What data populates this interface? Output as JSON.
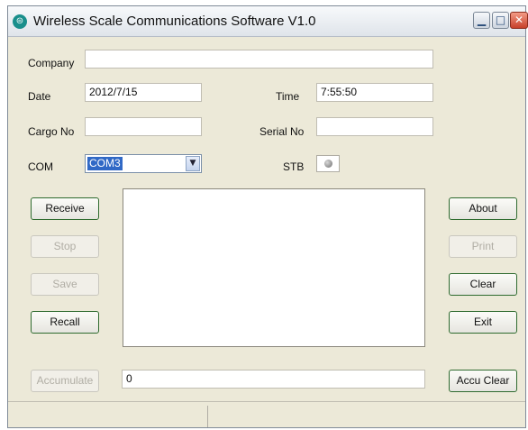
{
  "window": {
    "title": "Wireless Scale Communications Software V1.0",
    "icons": {
      "app": "scale-app-icon",
      "minimize": "minimize-icon",
      "maximize": "maximize-icon",
      "close": "close-icon"
    }
  },
  "form": {
    "company_label": "Company",
    "company_value": "",
    "date_label": "Date",
    "date_value": "2012/7/15",
    "time_label": "Time",
    "time_value": "7:55:50",
    "cargo_label": "Cargo No",
    "cargo_value": "",
    "serial_label": "Serial No",
    "serial_value": "",
    "com_label": "COM",
    "com_value": "COM3",
    "stb_label": "STB"
  },
  "buttons": {
    "receive": "Receive",
    "stop": "Stop",
    "save": "Save",
    "recall": "Recall",
    "about": "About",
    "print": "Print",
    "clear": "Clear",
    "exit": "Exit",
    "accumulate": "Accumulate",
    "accu_clear": "Accu Clear"
  },
  "accumulate": {
    "value": "0"
  },
  "log": {
    "text": ""
  }
}
